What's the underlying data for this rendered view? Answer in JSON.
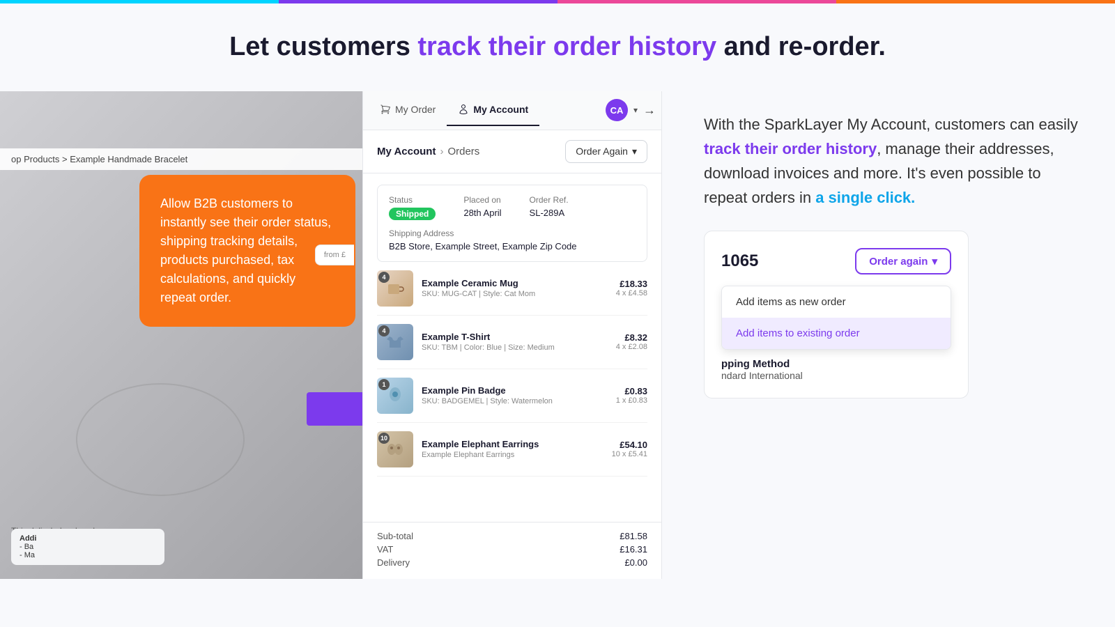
{
  "topbar": {
    "segments": [
      "cyan",
      "purple",
      "pink",
      "orange"
    ]
  },
  "headline": {
    "part1": "Let customers ",
    "highlight": "track their order history",
    "part2": " and re-order."
  },
  "left_panel": {
    "breadcrumb": "op Products > Example Handmade Bracelet",
    "tooltip": "Allow B2B customers to instantly see their order status, shipping tracking details, products purchased, tax calculations, and quickly repeat order.",
    "bottom_desc": "This deli wholesale colour or",
    "adding_label": "Addi",
    "adding_lines": [
      "- Ba",
      "- Ma"
    ]
  },
  "panel_nav": {
    "tab_order": "My Order",
    "tab_account": "My Account",
    "avatar": "CA",
    "icon_order": "🛒",
    "icon_account": "👤"
  },
  "panel_breadcrumb": {
    "my_account": "My Account",
    "orders": "Orders",
    "order_again_btn": "Order Again"
  },
  "order_header": {
    "status_label": "Status",
    "placed_label": "Placed on",
    "ref_label": "Order Ref.",
    "status_value": "Shipped",
    "placed_value": "28th April",
    "ref_value": "SL-289A",
    "shipping_label": "Shipping Address",
    "shipping_value": "B2B Store, Example Street, Example Zip Code"
  },
  "order_items": [
    {
      "name": "Example Ceramic Mug",
      "sku": "SKU: MUG-CAT | Style: Cat Mom",
      "total": "£18.33",
      "unit": "4 x £4.58",
      "qty": "4",
      "color": "mug"
    },
    {
      "name": "Example T-Shirt",
      "sku": "SKU: TBM | Color: Blue | Size: Medium",
      "total": "£8.32",
      "unit": "4 x £2.08",
      "qty": "4",
      "color": "shirt"
    },
    {
      "name": "Example Pin Badge",
      "sku": "SKU: BADGEMEL | Style: Watermelon",
      "total": "£0.83",
      "unit": "1 x £0.83",
      "qty": "1",
      "color": "badge"
    },
    {
      "name": "Example Elephant Earrings",
      "sku": "Example Elephant Earrings",
      "total": "£54.10",
      "unit": "10 x £5.41",
      "qty": "10",
      "color": "earrings"
    }
  ],
  "order_totals": {
    "subtotal_label": "Sub-total",
    "subtotal_value": "£81.58",
    "vat_label": "VAT",
    "vat_value": "£16.31",
    "delivery_label": "Delivery",
    "delivery_value": "£0.00"
  },
  "right_text": {
    "intro": "With the SparkLayer My Account, customers can easily ",
    "highlight1": "track their order history",
    "mid": ", manage their addresses, download invoices and more. It's even possible to repeat orders in ",
    "highlight2": "a single click.",
    "end": ""
  },
  "widget": {
    "order_num": "1065",
    "order_again_btn": "Order again",
    "dropdown_item1": "Add items as new order",
    "dropdown_item2": "Add items to existing order",
    "shipping_section_label": "pping Method",
    "shipping_method": "ndard International"
  }
}
